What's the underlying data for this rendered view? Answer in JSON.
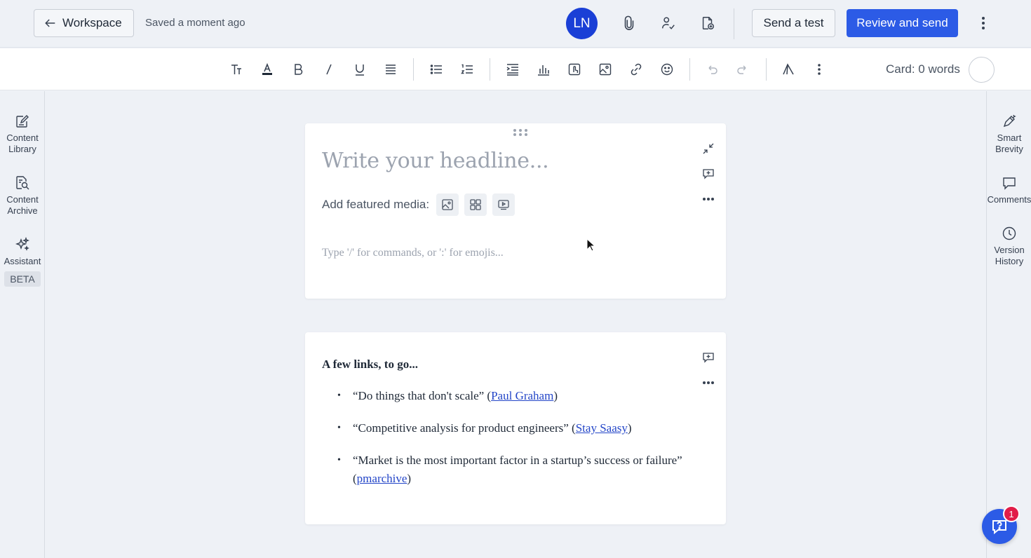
{
  "header": {
    "back_label": "Workspace",
    "saved_status": "Saved a moment ago",
    "avatar_initials": "LN",
    "send_test_label": "Send a test",
    "review_send_label": "Review and send",
    "brand_color": "#2c5be6"
  },
  "toolbar": {
    "icons": [
      "text-style-icon",
      "highlight-icon",
      "bold-icon",
      "italic-icon",
      "underline-icon",
      "align-icon",
      "bullet-list-icon",
      "numbered-list-icon",
      "indent-icon",
      "chart-icon",
      "touch-icon",
      "image-icon",
      "link-icon",
      "emoji-icon",
      "undo-icon",
      "redo-icon",
      "axios-logo-icon",
      "more-icon"
    ],
    "word_count": "Card: 0 words"
  },
  "left_sidebar": {
    "items": [
      {
        "label_line1": "Content",
        "label_line2": "Library",
        "icon": "edit-icon"
      },
      {
        "label_line1": "Content",
        "label_line2": "Archive",
        "icon": "search-doc-icon"
      },
      {
        "label_line1": "Assistant",
        "label_line2": "",
        "icon": "sparkles-icon",
        "badge": "BETA"
      }
    ]
  },
  "right_sidebar": {
    "items": [
      {
        "label_line1": "Smart",
        "label_line2": "Brevity",
        "icon": "pen-icon"
      },
      {
        "label_line1": "Comments",
        "label_line2": "",
        "icon": "comment-icon"
      },
      {
        "label_line1": "Version",
        "label_line2": "History",
        "icon": "clock-icon"
      }
    ]
  },
  "card1": {
    "headline_placeholder": "Write your headline...",
    "media_label": "Add featured media:",
    "body_placeholder": "Type '/' for commands, or ':' for emojis..."
  },
  "card2": {
    "title": "A few links, to go...",
    "items": [
      {
        "quote": "“Do things that don't scale” (",
        "link": "Paul Graham",
        "after": ")"
      },
      {
        "quote": "“Competitive analysis for product engineers” (",
        "link": "Stay Saasy",
        "after": ")"
      },
      {
        "quote": "“Market is the most important factor in a startup’s success or failure” (",
        "link": "pmarchive",
        "after": ")"
      }
    ]
  },
  "help": {
    "notification_count": "1"
  }
}
